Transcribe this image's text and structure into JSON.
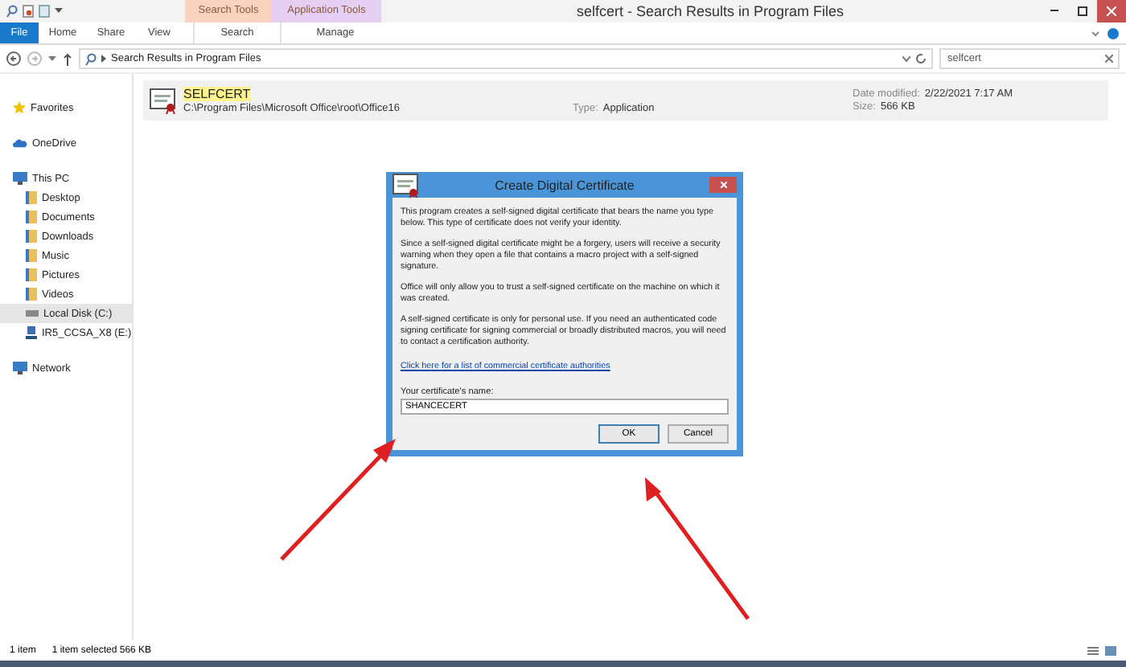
{
  "window": {
    "title": "selfcert - Search Results in Program Files"
  },
  "ribbon": {
    "context_groups": [
      {
        "label": "Search Tools",
        "color": "#f9d3c0"
      },
      {
        "label": "Application Tools",
        "color": "#e5cff2"
      }
    ],
    "tabs": [
      {
        "label": "File",
        "kind": "file"
      },
      {
        "label": "Home",
        "kind": "tab"
      },
      {
        "label": "Share",
        "kind": "tab"
      },
      {
        "label": "View",
        "kind": "tab"
      },
      {
        "label": "Search",
        "kind": "context"
      },
      {
        "label": "Manage",
        "kind": "context"
      }
    ]
  },
  "address": {
    "path": "Search Results in Program Files"
  },
  "search": {
    "value": "selfcert"
  },
  "sidebar": {
    "items": [
      {
        "label": "Favorites",
        "kind": "star",
        "selected": false
      },
      {
        "label": "OneDrive",
        "kind": "cloud",
        "selected": false
      },
      {
        "label": "This PC",
        "kind": "pc",
        "selected": false,
        "children": [
          {
            "label": "Desktop",
            "kind": "folder",
            "selected": false
          },
          {
            "label": "Documents",
            "kind": "folder",
            "selected": false
          },
          {
            "label": "Downloads",
            "kind": "folder",
            "selected": false
          },
          {
            "label": "Music",
            "kind": "folder",
            "selected": false
          },
          {
            "label": "Pictures",
            "kind": "folder",
            "selected": false
          },
          {
            "label": "Videos",
            "kind": "folder",
            "selected": false
          },
          {
            "label": "Local Disk (C:)",
            "kind": "drive",
            "selected": true
          },
          {
            "label": "IR5_CCSA_X8 (E:)",
            "kind": "net",
            "selected": false
          }
        ]
      },
      {
        "label": "Network",
        "kind": "network",
        "selected": false
      }
    ]
  },
  "result": {
    "name": "SELFCERT",
    "path": "C:\\Program Files\\Microsoft Office\\root\\Office16",
    "type_label": "Type:",
    "type": "Application",
    "date_label": "Date modified:",
    "date": "2/22/2021 7:17 AM",
    "size_label": "Size:",
    "size": "566 KB"
  },
  "dialog": {
    "title": "Create Digital Certificate",
    "paragraphs": [
      "This program creates a self-signed digital certificate that bears the name you type below. This type of certificate does not verify your identity.",
      "Since a self-signed digital certificate might be a forgery, users will receive a security warning when they open a file that contains a macro project with a self-signed signature.",
      "Office will only allow you to trust a self-signed certificate on the machine on which it was created.",
      "A self-signed certificate is only for personal use. If you need an authenticated code signing certificate for signing commercial or broadly distributed macros, you will need to contact a certification authority."
    ],
    "link": "Click here for a list of commercial certificate authorities",
    "field_label": "Your certificate's name:",
    "field_value": "SHANCECERT",
    "buttons": [
      {
        "label": "OK",
        "default": true
      },
      {
        "label": "Cancel",
        "default": false
      }
    ]
  },
  "status_bar": {
    "count": "1 item",
    "selection": "1 item selected  566 KB"
  }
}
